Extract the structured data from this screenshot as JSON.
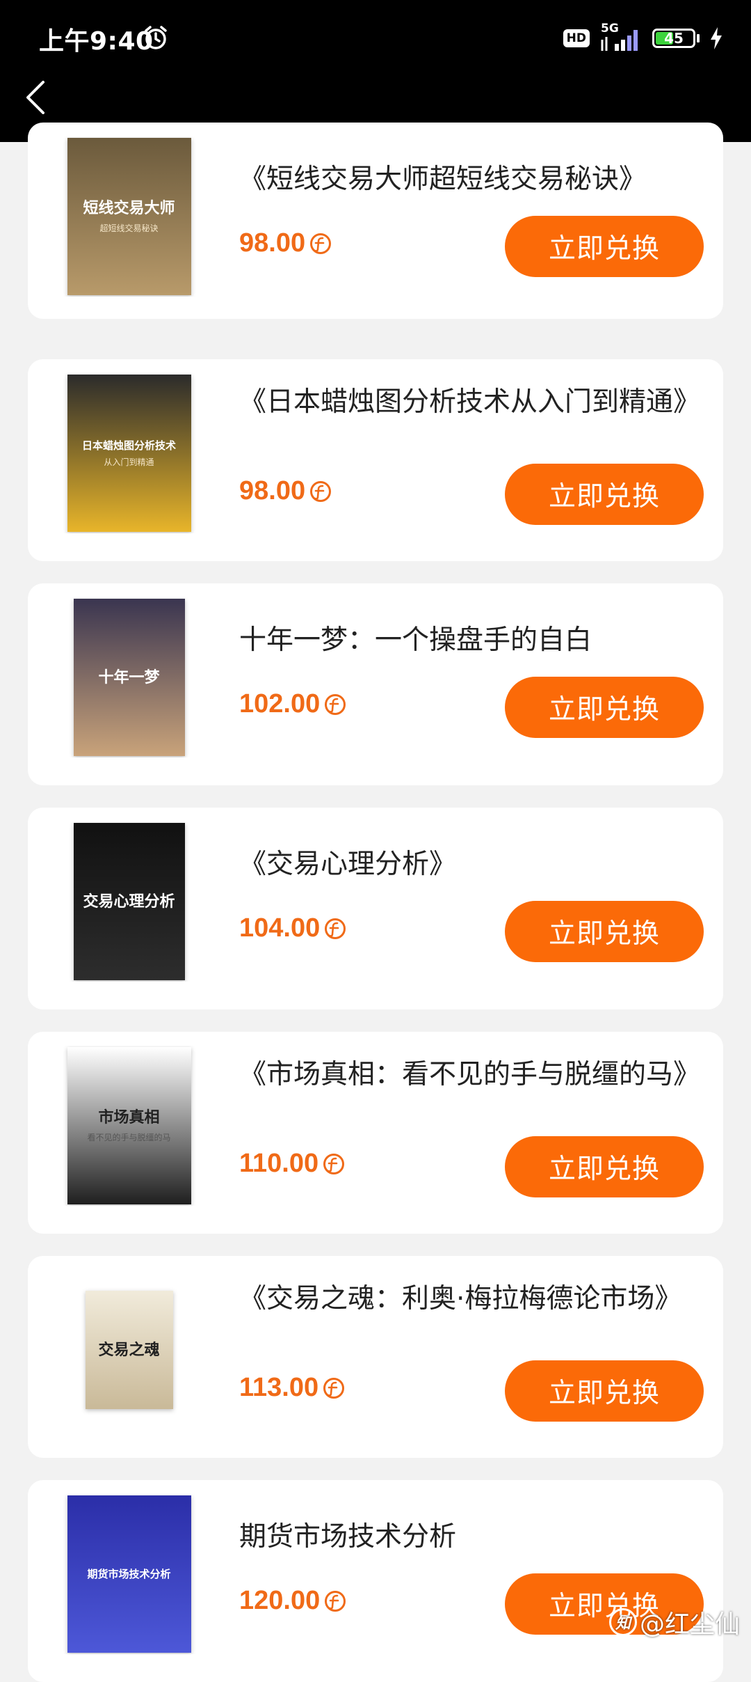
{
  "status_bar": {
    "time": "上午9:40",
    "hd": "HD",
    "network": "5G",
    "battery": "45",
    "battery_level": 0.45
  },
  "nav": {
    "back_icon": "chevron-left-icon"
  },
  "exchange_button_label": "立即兑换",
  "items": [
    {
      "title": "《短线交易大师超短线交易秘诀》",
      "price": "98.00",
      "cover_title": "短线交易大师",
      "cover_subtitle": "超短线交易秘诀",
      "cover_colors": [
        "#6b5a3c",
        "#b89a6a"
      ]
    },
    {
      "title": "《日本蜡烛图分析技术从入门到精通》",
      "price": "98.00",
      "cover_title": "日本蜡烛图分析技术",
      "cover_subtitle": "从入门到精通",
      "cover_colors": [
        "#2b2b2b",
        "#e8b52a"
      ]
    },
    {
      "title": "十年一梦：一个操盘手的自白",
      "price": "102.00",
      "cover_title": "十年一梦",
      "cover_subtitle": "",
      "cover_colors": [
        "#3a3550",
        "#c9a37a"
      ]
    },
    {
      "title": "《交易心理分析》",
      "price": "104.00",
      "cover_title": "交易心理分析",
      "cover_subtitle": "",
      "cover_colors": [
        "#111111",
        "#2d2d2d"
      ]
    },
    {
      "title": "《市场真相：看不见的手与脱缰的马》",
      "price": "110.00",
      "cover_title": "市场真相",
      "cover_subtitle": "看不见的手与脱缰的马",
      "cover_colors": [
        "#ffffff",
        "#1f1f1f"
      ]
    },
    {
      "title": "《交易之魂：利奥·梅拉梅德论市场》",
      "price": "113.00",
      "cover_title": "交易之魂",
      "cover_subtitle": "",
      "cover_colors": [
        "#f1ebdb",
        "#c9b998"
      ]
    },
    {
      "title": "期货市场技术分析",
      "price": "120.00",
      "cover_title": "期货市场技术分析",
      "cover_subtitle": "",
      "cover_colors": [
        "#2b2ea8",
        "#4d58d8"
      ]
    }
  ],
  "watermark": {
    "logo": "知",
    "text": "@红尘仙"
  },
  "colors": {
    "accent": "#fb6a08",
    "price": "#f06a17",
    "background": "#f2f2f2"
  }
}
